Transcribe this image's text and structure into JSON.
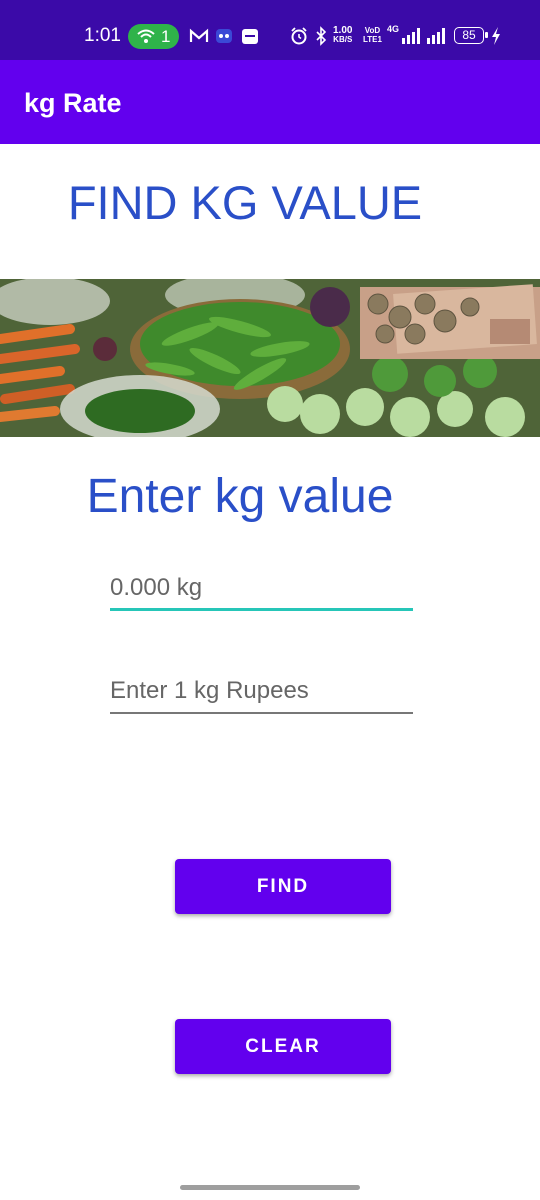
{
  "status_bar": {
    "time": "1:01",
    "hotspot_count": "1",
    "net_speed_value": "1.00",
    "net_speed_unit": "KB/S",
    "volte_top": "VoD",
    "volte_bottom": "LTE1",
    "network_type": "4G",
    "battery_level": "85",
    "icons": [
      "hotspot-icon",
      "gmail-icon",
      "game-icon",
      "notification-icon",
      "alarm-icon",
      "bluetooth-icon",
      "signal-icon",
      "signal-icon-2",
      "charging-icon"
    ]
  },
  "app_bar": {
    "title": "kg Rate",
    "color": "#6200ee"
  },
  "main": {
    "headline": "FIND KG VALUE",
    "subheading": "Enter kg value",
    "kg_input": {
      "value": "0.000 kg",
      "placeholder": "0.000 kg"
    },
    "rupee_input": {
      "value": "",
      "placeholder": "Enter 1 kg Rupees"
    },
    "find_label": "FIND",
    "clear_label": "CLEAR",
    "accent_color": "#2a4fc8"
  }
}
